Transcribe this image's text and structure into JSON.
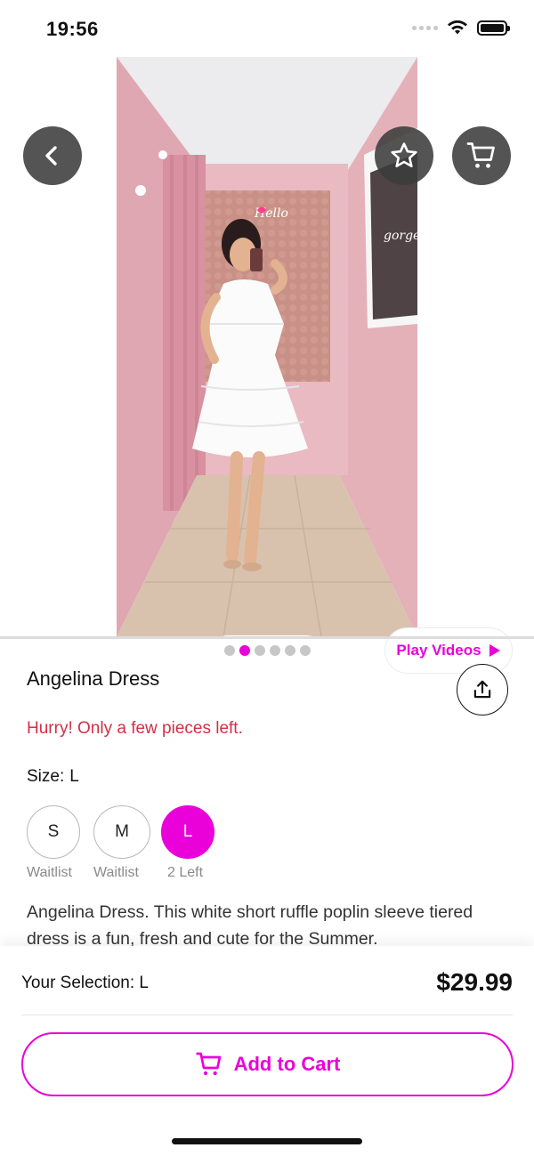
{
  "status_bar": {
    "time": "19:56"
  },
  "hero": {
    "image_description_icon": "product-photo",
    "carousel": {
      "count": 6,
      "active_index": 1
    },
    "play_videos_label": "Play Videos"
  },
  "product": {
    "title": "Angelina Dress",
    "hurry_text": "Hurry! Only a few pieces left.",
    "size_label": "Size:",
    "size_value": "L",
    "sizes": [
      {
        "label": "S",
        "note": "Waitlist",
        "selected": false
      },
      {
        "label": "M",
        "note": "Waitlist",
        "selected": false
      },
      {
        "label": "L",
        "note": "2 Left",
        "selected": true
      }
    ],
    "description": "Angelina Dress. This white short ruffle poplin sleeve tiered dress is a fun, fresh and cute for the Summer."
  },
  "footer": {
    "selection_label": "Your Selection: L",
    "price": "$29.99",
    "add_to_cart_label": "Add to Cart"
  },
  "colors": {
    "accent": "#ea00d9",
    "warning": "#d32f45",
    "wall_pink": "#e7b8bf"
  }
}
